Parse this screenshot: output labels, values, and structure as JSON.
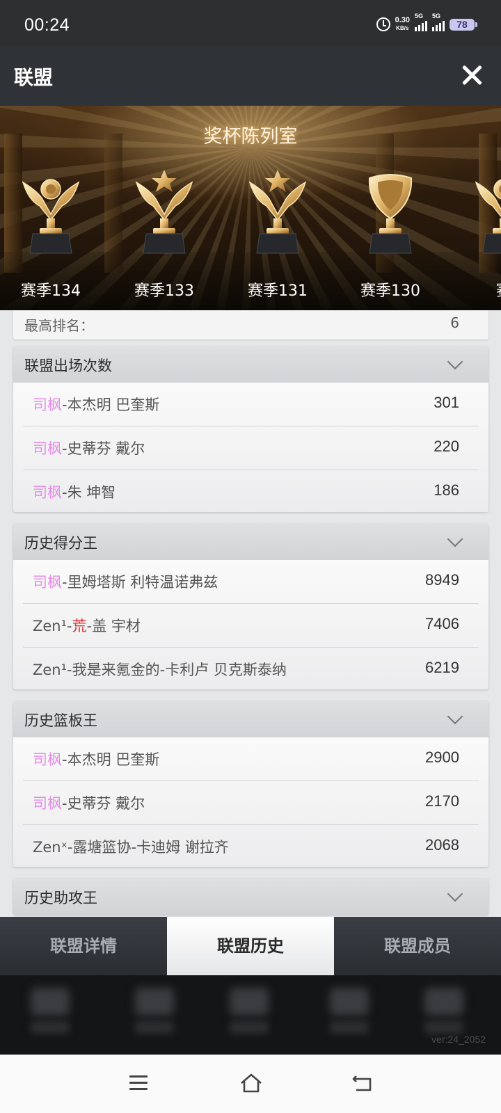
{
  "status_bar": {
    "time": "00:24",
    "speed_value": "0.30",
    "speed_unit": "KB/s",
    "sim1": "5G",
    "sim2": "5G",
    "battery": "78"
  },
  "header": {
    "title": "联盟",
    "close_icon": "close-icon"
  },
  "banner": {
    "title": "奖杯陈列室",
    "trophies": [
      {
        "label": "赛季134",
        "icon": "winged-trophy-icon"
      },
      {
        "label": "赛季133",
        "icon": "star-trophy-icon"
      },
      {
        "label": "赛季131",
        "icon": "star-trophy-icon"
      },
      {
        "label": "赛季130",
        "icon": "shield-trophy-icon"
      },
      {
        "label": "赛",
        "icon": "trophy-icon"
      }
    ]
  },
  "best_rank": {
    "label": "最高排名：",
    "value": "6"
  },
  "sections": [
    {
      "title": "联盟出场次数",
      "rows": [
        {
          "prefix": "司枫",
          "name": "-本杰明 巴奎斯",
          "value": "301"
        },
        {
          "prefix": "司枫",
          "name": "-史蒂芬 戴尔",
          "value": "220"
        },
        {
          "prefix": "司枫",
          "name": "-朱 坤智",
          "value": "186"
        }
      ]
    },
    {
      "title": "历史得分王",
      "rows": [
        {
          "prefix": "司枫",
          "name": "-里姆塔斯 利特温诺弗兹",
          "value": "8949"
        },
        {
          "pre": "Zen¹-",
          "red": "荒",
          "name": "-盖 宇材",
          "value": "7406"
        },
        {
          "pre": "Zen¹-我是来氪金的-卡利卢 贝克斯泰纳",
          "value": "6219"
        }
      ]
    },
    {
      "title": "历史篮板王",
      "rows": [
        {
          "prefix": "司枫",
          "name": "-本杰明 巴奎斯",
          "value": "2900"
        },
        {
          "prefix": "司枫",
          "name": "-史蒂芬 戴尔",
          "value": "2170"
        },
        {
          "pre": "Zenˣ-露塘篮协-卡迪姆 谢拉齐",
          "value": "2068"
        }
      ]
    },
    {
      "title": "历史助攻王",
      "rows": []
    }
  ],
  "tabs": [
    {
      "label": "联盟详情",
      "active": false
    },
    {
      "label": "联盟历史",
      "active": true
    },
    {
      "label": "联盟成员",
      "active": false
    }
  ],
  "version": "ver:24_2052",
  "nav_icons": [
    "menu-icon",
    "home-icon",
    "back-icon"
  ],
  "colors": {
    "accent_pink": "#e38be6",
    "accent_red": "#e03030",
    "header_bg": "#2f3237"
  }
}
